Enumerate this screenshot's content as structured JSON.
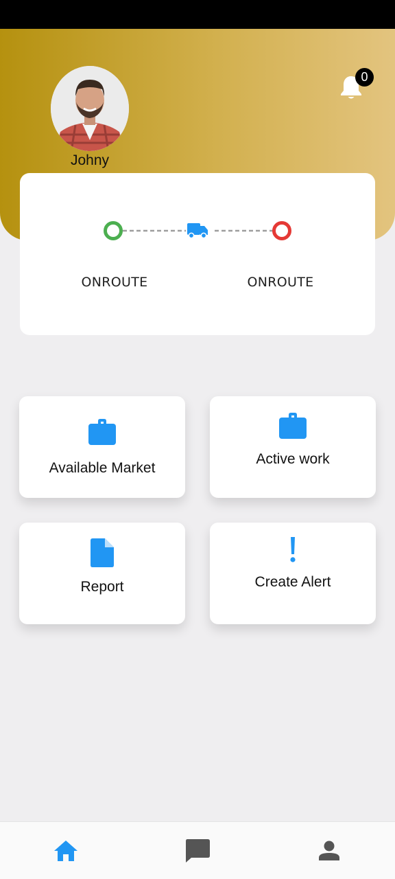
{
  "user": {
    "name": "Johny"
  },
  "notifications": {
    "count": "0",
    "icon": "bell-icon"
  },
  "route": {
    "start_label": "ONROUTE",
    "end_label": "ONROUTE",
    "start_color": "#4caf50",
    "end_color": "#e53935",
    "vehicle_icon": "truck-icon",
    "accent": "#2196f3"
  },
  "tiles": [
    {
      "label": "Available Market",
      "icon": "briefcase-icon"
    },
    {
      "label": "Active work",
      "icon": "briefcase-icon"
    },
    {
      "label": "Report",
      "icon": "document-icon"
    },
    {
      "label": "Create Alert",
      "icon": "exclamation-icon"
    }
  ],
  "bottom_nav": [
    {
      "icon": "home-icon",
      "active": true
    },
    {
      "icon": "chat-icon",
      "active": false
    },
    {
      "icon": "person-icon",
      "active": false
    }
  ],
  "colors": {
    "header_start": "#b5910f",
    "header_end": "#e3c47f",
    "accent": "#2196f3",
    "inactive_icon": "#555555"
  }
}
